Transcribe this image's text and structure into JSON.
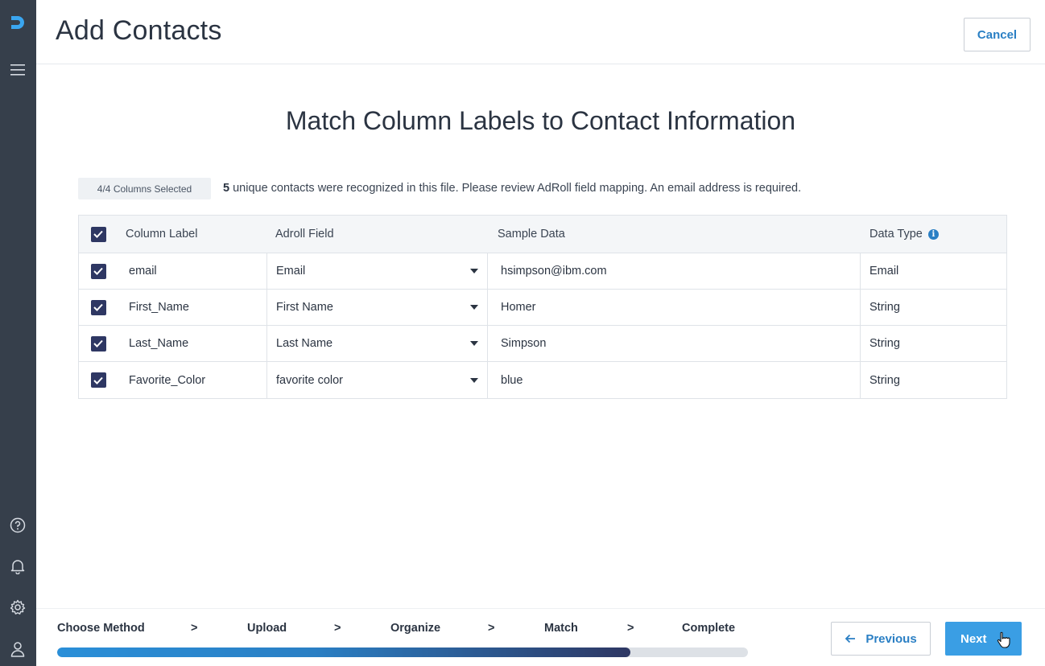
{
  "header": {
    "title": "Add Contacts",
    "cancel_label": "Cancel"
  },
  "sidebar": {
    "logo_icon": "adroll-logo-icon",
    "items": [
      {
        "name": "menu-icon"
      },
      {
        "name": "help-icon"
      },
      {
        "name": "bell-icon"
      },
      {
        "name": "gear-icon"
      },
      {
        "name": "user-icon"
      }
    ]
  },
  "main": {
    "heading": "Match Column Labels to Contact Information",
    "columns_selected": "4/4 Columns Selected",
    "summary_count": "5",
    "summary_text": " unique contacts were recognized in this file. Please review AdRoll field mapping. An email address is required."
  },
  "table": {
    "headers": {
      "column_label": "Column Label",
      "adroll_field": "Adroll Field",
      "sample_data": "Sample Data",
      "data_type": "Data Type"
    },
    "rows": [
      {
        "label": "email",
        "field": "Email",
        "sample": "hsimpson@ibm.com",
        "type": "Email",
        "checked": true
      },
      {
        "label": "First_Name",
        "field": "First Name",
        "sample": "Homer",
        "type": "String",
        "checked": true
      },
      {
        "label": "Last_Name",
        "field": "Last Name",
        "sample": "Simpson",
        "type": "String",
        "checked": true
      },
      {
        "label": "Favorite_Color",
        "field": "favorite color",
        "sample": "blue",
        "type": "String",
        "checked": true
      }
    ]
  },
  "footer": {
    "steps": [
      "Choose Method",
      "Upload",
      "Organize",
      "Match",
      "Complete"
    ],
    "separator": ">",
    "progress_fraction": 0.83,
    "previous_label": "Previous",
    "next_label": "Next"
  },
  "colors": {
    "sidebar": "#363f4b",
    "accent": "#2a7fc4",
    "checkbox": "#2e3763",
    "next_button": "#3a9ee4"
  }
}
